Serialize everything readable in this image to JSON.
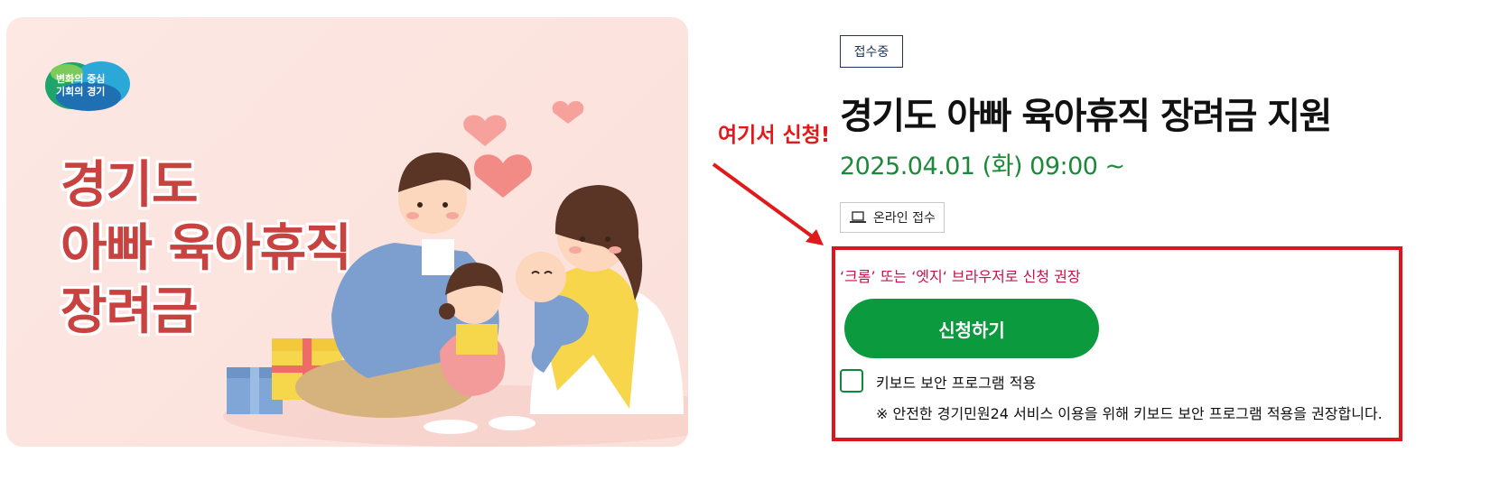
{
  "banner": {
    "logo_line1": "변화의 중심",
    "logo_line2": "기회의 경기",
    "title_line1": "경기도",
    "title_line2": "아빠 육아휴직",
    "title_line3": "장려금"
  },
  "annotation": {
    "text": "여기서 신청!"
  },
  "status_badge": "접수중",
  "page_title": "경기도 아빠 육아휴직 장려금 지원",
  "date_range": "2025.04.01 (화) 09:00 ~",
  "online_button": {
    "label": "온라인 접수",
    "icon": "laptop-icon"
  },
  "browser_notice": "‘크롬’ 또는 ‘엣지‘ 브라우저로 신청 권장",
  "apply_button": "신청하기",
  "keyboard_security": {
    "label": "키보드 보안 프로그램 적용",
    "checked": false,
    "note": "※ 안전한 경기민원24 서비스 이용을 위해 키보드 보안 프로그램 적용을 권장합니다."
  },
  "colors": {
    "accent_green": "#0b9a3d",
    "date_green": "#1a8a3a",
    "annotation_red": "#e0191b",
    "notice_magenta": "#c4124b",
    "banner_title_red": "#c8423f"
  }
}
